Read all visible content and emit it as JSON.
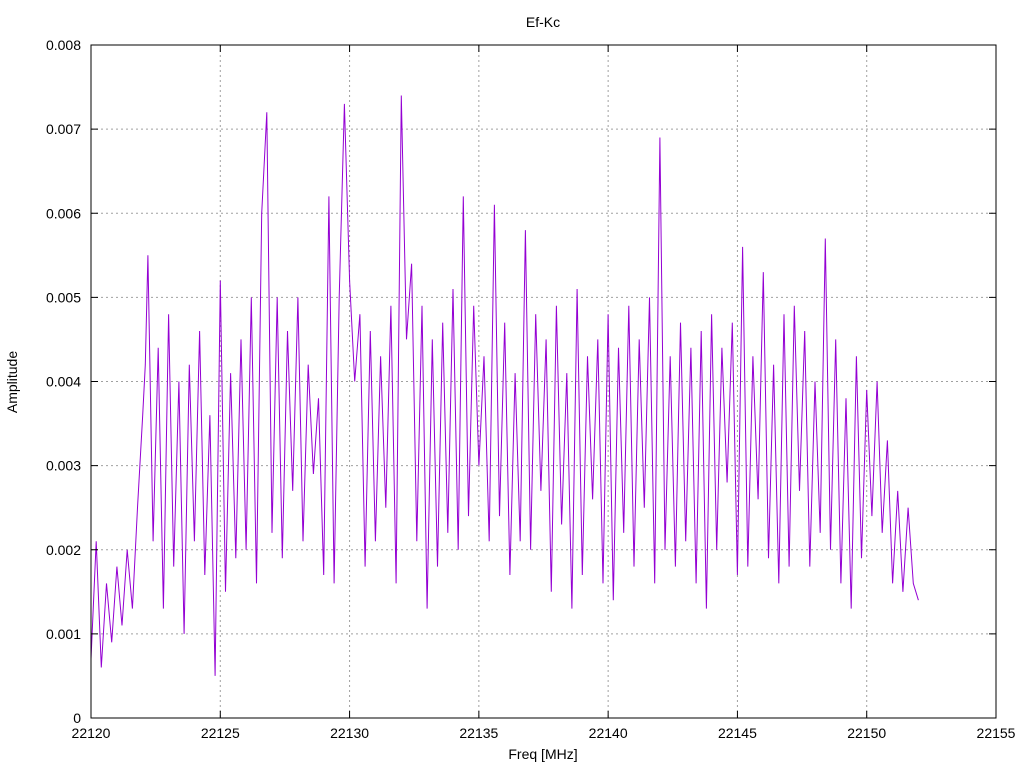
{
  "chart_data": {
    "type": "line",
    "title": "Ef-Kc",
    "xlabel": "Freq [MHz]",
    "ylabel": "Amplitude",
    "xlim": [
      22120,
      22155
    ],
    "ylim": [
      0,
      0.008
    ],
    "xticks": [
      22120,
      22125,
      22130,
      22135,
      22140,
      22145,
      22150,
      22155
    ],
    "yticks": [
      0,
      0.001,
      0.002,
      0.003,
      0.004,
      0.005,
      0.006,
      0.007,
      0.008
    ],
    "xtick_labels": [
      "22120",
      "22125",
      "22130",
      "22135",
      "22140",
      "22145",
      "22150",
      "22155"
    ],
    "ytick_labels": [
      "0",
      "0.001",
      "0.002",
      "0.003",
      "0.004",
      "0.005",
      "0.006",
      "0.007",
      "0.008"
    ],
    "grid": true,
    "legend": "none",
    "series": [
      {
        "color": "#9400d3",
        "x": [
          22120.0,
          22120.2,
          22120.4,
          22120.6,
          22120.8,
          22121.0,
          22121.2,
          22121.4,
          22121.6,
          22121.8,
          22122.0,
          22122.1,
          22122.2,
          22122.4,
          22122.6,
          22122.8,
          22123.0,
          22123.2,
          22123.4,
          22123.6,
          22123.8,
          22124.0,
          22124.2,
          22124.4,
          22124.6,
          22124.8,
          22125.0,
          22125.2,
          22125.4,
          22125.6,
          22125.8,
          22126.0,
          22126.2,
          22126.4,
          22126.6,
          22126.8,
          22127.0,
          22127.2,
          22127.4,
          22127.6,
          22127.8,
          22128.0,
          22128.2,
          22128.4,
          22128.6,
          22128.8,
          22129.0,
          22129.2,
          22129.4,
          22129.6,
          22129.8,
          22130.0,
          22130.2,
          22130.4,
          22130.6,
          22130.8,
          22131.0,
          22131.2,
          22131.4,
          22131.6,
          22131.8,
          22132.0,
          22132.2,
          22132.4,
          22132.6,
          22132.8,
          22133.0,
          22133.2,
          22133.4,
          22133.6,
          22133.8,
          22134.0,
          22134.2,
          22134.4,
          22134.6,
          22134.8,
          22135.0,
          22135.2,
          22135.4,
          22135.6,
          22135.8,
          22136.0,
          22136.2,
          22136.4,
          22136.6,
          22136.8,
          22137.0,
          22137.2,
          22137.4,
          22137.6,
          22137.8,
          22138.0,
          22138.2,
          22138.4,
          22138.6,
          22138.8,
          22139.0,
          22139.2,
          22139.4,
          22139.6,
          22139.8,
          22140.0,
          22140.2,
          22140.4,
          22140.6,
          22140.8,
          22141.0,
          22141.2,
          22141.4,
          22141.6,
          22141.8,
          22142.0,
          22142.2,
          22142.4,
          22142.6,
          22142.8,
          22143.0,
          22143.2,
          22143.4,
          22143.6,
          22143.8,
          22144.0,
          22144.2,
          22144.4,
          22144.6,
          22144.8,
          22145.0,
          22145.2,
          22145.4,
          22145.6,
          22145.8,
          22146.0,
          22146.2,
          22146.4,
          22146.6,
          22146.8,
          22147.0,
          22147.2,
          22147.4,
          22147.6,
          22147.8,
          22148.0,
          22148.2,
          22148.4,
          22148.6,
          22148.8,
          22149.0,
          22149.2,
          22149.4,
          22149.6,
          22149.8,
          22150.0,
          22150.2,
          22150.4,
          22150.6,
          22150.8,
          22151.0,
          22151.2,
          22151.4,
          22151.6,
          22151.8,
          22152.0
        ],
        "y": [
          0.0007,
          0.0021,
          0.0006,
          0.0016,
          0.0009,
          0.0018,
          0.0011,
          0.002,
          0.0013,
          0.0025,
          0.0036,
          0.0042,
          0.0055,
          0.0021,
          0.0044,
          0.0013,
          0.0048,
          0.0018,
          0.004,
          0.001,
          0.0042,
          0.0021,
          0.0046,
          0.0017,
          0.0036,
          0.0005,
          0.0052,
          0.0015,
          0.0041,
          0.0019,
          0.0045,
          0.002,
          0.005,
          0.0016,
          0.006,
          0.0072,
          0.0022,
          0.005,
          0.0019,
          0.0046,
          0.0027,
          0.005,
          0.0021,
          0.0042,
          0.0029,
          0.0038,
          0.0017,
          0.0062,
          0.0016,
          0.005,
          0.0073,
          0.0052,
          0.004,
          0.0048,
          0.0018,
          0.0046,
          0.0021,
          0.0043,
          0.0025,
          0.0049,
          0.0016,
          0.0074,
          0.0045,
          0.0054,
          0.0021,
          0.0049,
          0.0013,
          0.0045,
          0.0018,
          0.0047,
          0.0022,
          0.0051,
          0.002,
          0.0062,
          0.0024,
          0.0049,
          0.003,
          0.0043,
          0.0021,
          0.0061,
          0.0024,
          0.0047,
          0.0017,
          0.0041,
          0.0021,
          0.0058,
          0.002,
          0.0048,
          0.0027,
          0.0045,
          0.0015,
          0.0049,
          0.0023,
          0.0041,
          0.0013,
          0.0051,
          0.0017,
          0.0043,
          0.0026,
          0.0045,
          0.0016,
          0.0048,
          0.0014,
          0.0044,
          0.0022,
          0.0049,
          0.0018,
          0.0045,
          0.0025,
          0.005,
          0.0016,
          0.0069,
          0.002,
          0.0043,
          0.0018,
          0.0047,
          0.0021,
          0.0044,
          0.0016,
          0.0046,
          0.0013,
          0.0048,
          0.002,
          0.0044,
          0.0028,
          0.0047,
          0.0017,
          0.0056,
          0.0018,
          0.0043,
          0.0026,
          0.0053,
          0.0019,
          0.0042,
          0.0016,
          0.0048,
          0.0018,
          0.0049,
          0.0027,
          0.0046,
          0.0018,
          0.004,
          0.0022,
          0.0057,
          0.002,
          0.0045,
          0.0016,
          0.0038,
          0.0013,
          0.0043,
          0.0019,
          0.0039,
          0.0024,
          0.004,
          0.0022,
          0.0033,
          0.0016,
          0.0027,
          0.0015,
          0.0025,
          0.0016,
          0.0014
        ]
      }
    ]
  }
}
